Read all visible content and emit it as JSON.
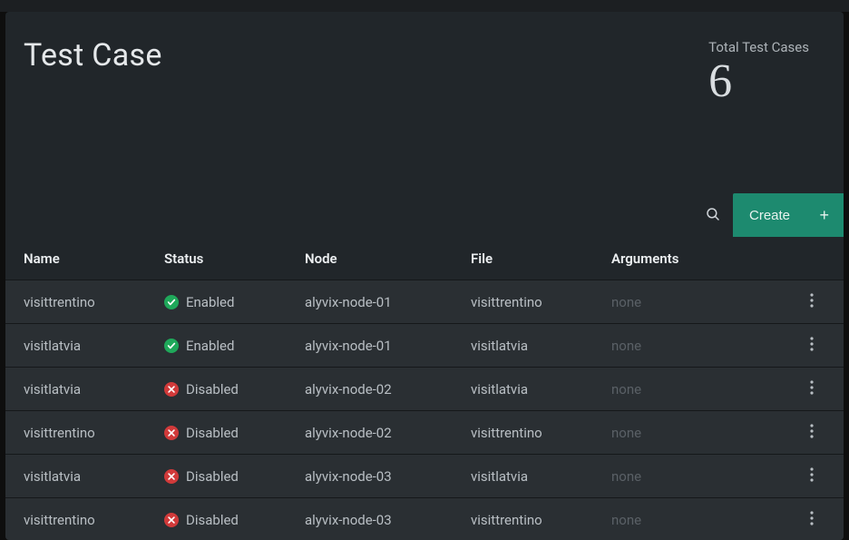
{
  "header": {
    "title": "Test Case",
    "total_label": "Total Test Cases",
    "total_value": "6"
  },
  "toolbar": {
    "search_icon": "search",
    "create_label": "Create",
    "create_plus": "+"
  },
  "table": {
    "headers": {
      "name": "Name",
      "status": "Status",
      "node": "Node",
      "file": "File",
      "arguments": "Arguments"
    },
    "status_labels": {
      "enabled": "Enabled",
      "disabled": "Disabled"
    },
    "none_text": "none",
    "rows": [
      {
        "name": "visittrentino",
        "status": "enabled",
        "node": "alyvix-node-01",
        "file": "visittrentino",
        "args": null
      },
      {
        "name": "visitlatvia",
        "status": "enabled",
        "node": "alyvix-node-01",
        "file": "visitlatvia",
        "args": null
      },
      {
        "name": "visitlatvia",
        "status": "disabled",
        "node": "alyvix-node-02",
        "file": "visitlatvia",
        "args": null
      },
      {
        "name": "visittrentino",
        "status": "disabled",
        "node": "alyvix-node-02",
        "file": "visittrentino",
        "args": null
      },
      {
        "name": "visitlatvia",
        "status": "disabled",
        "node": "alyvix-node-03",
        "file": "visitlatvia",
        "args": null
      },
      {
        "name": "visittrentino",
        "status": "disabled",
        "node": "alyvix-node-03",
        "file": "visittrentino",
        "args": null
      }
    ]
  }
}
